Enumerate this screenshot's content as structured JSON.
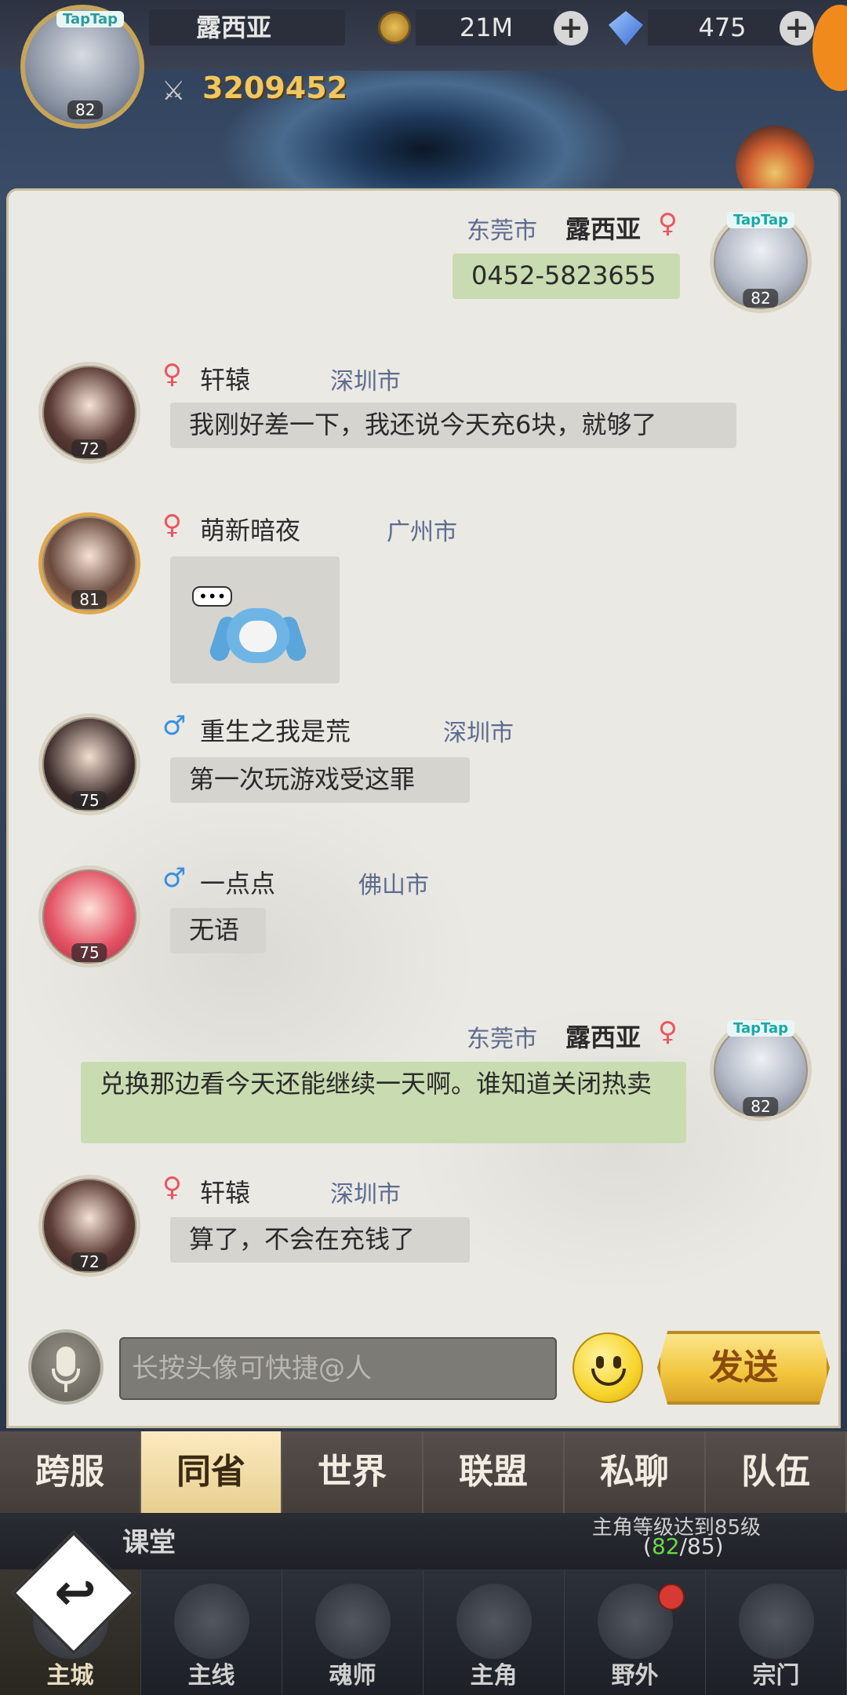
{
  "header": {
    "player_name": "露西亚",
    "avatar_level": "82",
    "avatar_badge": "TapTap",
    "gold": "21M",
    "gems": "475",
    "power": "3209452"
  },
  "chat": {
    "messages": [
      {
        "sender": "露西亚",
        "city": "东莞市",
        "gender": "♀",
        "text": "0452-5823655",
        "level": "82",
        "badge": "TapTap"
      },
      {
        "sender": "轩辕",
        "city": "深圳市",
        "gender": "♀",
        "text": "我刚好差一下，我还说今天充6块，就够了",
        "level": "72"
      },
      {
        "sender": "萌新暗夜",
        "city": "广州市",
        "gender": "♀",
        "text": "",
        "level": "81"
      },
      {
        "sender": "重生之我是荒",
        "city": "深圳市",
        "gender": "♂",
        "text": "第一次玩游戏受这罪",
        "level": "75"
      },
      {
        "sender": "一点点",
        "city": "佛山市",
        "gender": "♂",
        "text": "无语",
        "level": "75"
      },
      {
        "sender": "露西亚",
        "city": "东莞市",
        "gender": "♀",
        "text": "兑换那边看今天还能继续一天啊。谁知道关闭热卖",
        "level": "82",
        "badge": "TapTap"
      },
      {
        "sender": "轩辕",
        "city": "深圳市",
        "gender": "♀",
        "text": "算了，不会在充钱了",
        "level": "72"
      }
    ],
    "sticker_dots": "•••",
    "input_placeholder": "长按头像可快捷@人",
    "send_label": "发送"
  },
  "tabs": [
    "跨服",
    "同省",
    "世界",
    "联盟",
    "私聊",
    "队伍"
  ],
  "active_tab": "同省",
  "strip": {
    "ketang": "课堂",
    "quest_text": "主角等级达到85级",
    "quest_open": "(",
    "quest_current": "82",
    "quest_total": "/85)"
  },
  "nav": [
    "主城",
    "主线",
    "魂师",
    "主角",
    "野外",
    "宗门"
  ],
  "icons": {
    "back": "↩",
    "power": "⚔",
    "plus": "+"
  },
  "colors": {
    "female": "#e9555f",
    "male": "#3a8fe0",
    "city": "#5c6c8f",
    "my_bubble": "#c9dcb1",
    "bubble": "#d6d4cf"
  }
}
